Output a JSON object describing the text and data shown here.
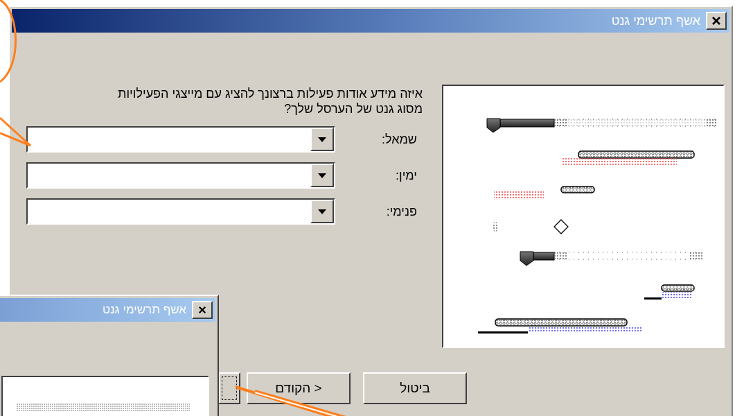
{
  "window": {
    "title": "אשף תרשימי גנט"
  },
  "question": "איזה מידע אודות פעילות ברצונך להציג עם מייצגי הפעילויות מסוג גנט של הערסל שלך?",
  "fields": [
    {
      "label": "שמאל:"
    },
    {
      "label": "ימין:"
    },
    {
      "label": "פנימי:"
    }
  ],
  "buttons": [
    {
      "label": "ביטול"
    },
    {
      "label": "< הקודם"
    }
  ],
  "second_window": {
    "title": "אשף תרשימי גנט"
  }
}
